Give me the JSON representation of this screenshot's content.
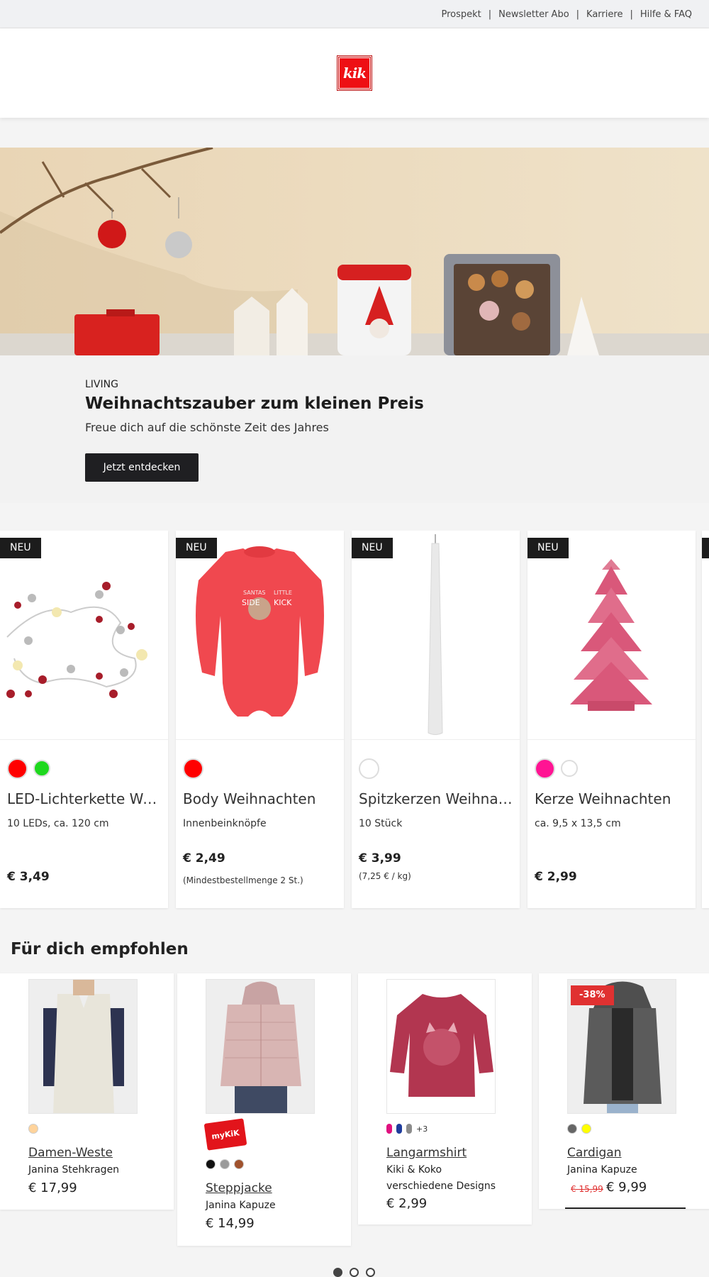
{
  "topbar": {
    "links": [
      "Prospekt",
      "Newsletter Abo",
      "Karriere",
      "Hilfe & FAQ"
    ],
    "separator": "|"
  },
  "header": {
    "logo_text": "kik",
    "brand_color": "#ee0f14"
  },
  "hero": {
    "kicker": "LIVING",
    "title": "Weihnachtszauber zum kleinen Preis",
    "subtitle": "Freue dich auf die schönste Zeit des Jahres",
    "cta": "Jetzt entdecken"
  },
  "products": [
    {
      "badge": "NEU",
      "name": "LED-Lichterkette Weih...",
      "desc": "10 LEDs, ca. 120 cm",
      "price": "€ 3,49",
      "note": "",
      "swatches": [
        "#ff0000",
        "#1ed81e"
      ]
    },
    {
      "badge": "NEU",
      "name": "Body Weihnachten",
      "desc": "Innenbeinknöpfe",
      "price": "€ 2,49",
      "note": "(Mindestbestellmenge 2 St.)",
      "swatches": [
        "#ff0000"
      ]
    },
    {
      "badge": "NEU",
      "name": "Spitzkerzen Weihnach...",
      "desc": "10 Stück",
      "price": "€ 3,99",
      "note": "(7,25 € / kg)",
      "swatches": [
        "#ffffff"
      ]
    },
    {
      "badge": "NEU",
      "name": "Kerze Weihnachten",
      "desc": "ca. 9,5 x 13,5 cm",
      "price": "€ 2,99",
      "note": "",
      "swatches": [
        "#ff1493",
        "#ffffff"
      ]
    }
  ],
  "recommended": {
    "title": "Für dich empfohlen",
    "items": [
      {
        "name": "Damen-Weste",
        "desc": "Janina Stehkragen",
        "price": "€ 17,99",
        "colors": [
          "#ffd39b"
        ]
      },
      {
        "name": "Steppjacke",
        "desc": "Janina Kapuze",
        "price": "€ 14,99",
        "badge": "myKiK",
        "colors": [
          "#111111",
          "#9a9a9a",
          "#a0522d"
        ]
      },
      {
        "name": "Langarmshirt",
        "desc": "Kiki & Koko verschiedene Designs",
        "desc_line1": "Kiki & Koko",
        "desc_line2": "verschiedene Designs",
        "price": "€ 2,99",
        "more_colors": "+3",
        "colors": [
          "#e0117f",
          "#1f3c9c",
          "#8c8c8c"
        ]
      },
      {
        "name": "Cardigan",
        "desc": "Janina Kapuze",
        "price": "€ 9,99",
        "old_price": "€ 15,99",
        "discount": "-38%",
        "colors": [
          "#666666",
          "#ffff00"
        ]
      }
    ]
  },
  "pager": {
    "count": 3,
    "active": 0
  }
}
